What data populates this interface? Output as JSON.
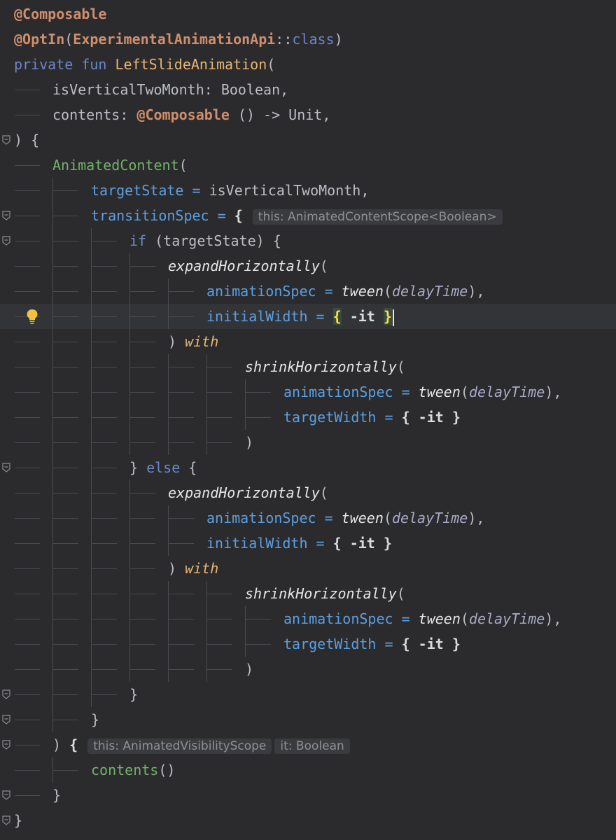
{
  "editor": {
    "hints": {
      "transition_scope": "this: AnimatedContentScope<Boolean>",
      "visibility_scope": "this: AnimatedVisibilityScope",
      "it_type": "it: Boolean"
    },
    "lines": [
      {
        "indent": 0,
        "tokens": [
          [
            "@Composable",
            "annotation"
          ]
        ]
      },
      {
        "indent": 0,
        "tokens": [
          [
            "@OptIn",
            "annotation"
          ],
          [
            "(",
            "punct"
          ],
          [
            "ExperimentalAnimationApi",
            "annotation"
          ],
          [
            "::",
            "punct"
          ],
          [
            "class",
            "keyword"
          ],
          [
            ")",
            "punct"
          ]
        ]
      },
      {
        "indent": 0,
        "tokens": [
          [
            "private fun ",
            "keyword"
          ],
          [
            "LeftSlideAnimation",
            "fn-decl"
          ],
          [
            "(",
            "punct"
          ]
        ]
      },
      {
        "indent": 1,
        "tokens": [
          [
            "isVerticalTwoMonth",
            "param"
          ],
          [
            ": Boolean,",
            "type"
          ]
        ]
      },
      {
        "indent": 1,
        "tokens": [
          [
            "contents",
            "param"
          ],
          [
            ": ",
            "punct"
          ],
          [
            "@Composable",
            "annotation"
          ],
          [
            " () -> Unit,",
            "type"
          ]
        ]
      },
      {
        "indent": 0,
        "fold": true,
        "tokens": [
          [
            ") {",
            "punct"
          ]
        ]
      },
      {
        "indent": 1,
        "tokens": [
          [
            "AnimatedContent",
            "call-green"
          ],
          [
            "(",
            "punct"
          ]
        ]
      },
      {
        "indent": 2,
        "tokens": [
          [
            "targetState",
            "named-arg"
          ],
          [
            " = ",
            "op"
          ],
          [
            "isVerticalTwoMonth,",
            "param"
          ]
        ]
      },
      {
        "indent": 2,
        "fold": true,
        "tokens": [
          [
            "transitionSpec",
            "named-arg"
          ],
          [
            " = ",
            "op"
          ],
          [
            "{ ",
            "bold"
          ]
        ],
        "hint": "transition_scope"
      },
      {
        "indent": 3,
        "fold": true,
        "tokens": [
          [
            "if",
            "keyword"
          ],
          [
            " (targetState) {",
            "punct"
          ]
        ]
      },
      {
        "indent": 4,
        "tokens": [
          [
            "expandHorizontally",
            "italic-fn"
          ],
          [
            "(",
            "punct"
          ]
        ]
      },
      {
        "indent": 5,
        "tokens": [
          [
            "animationSpec",
            "named-arg"
          ],
          [
            " = ",
            "op"
          ],
          [
            "tween",
            "italic-fn"
          ],
          [
            "(",
            "punct"
          ],
          [
            "delayTime",
            "italic-var"
          ],
          [
            "),",
            "punct"
          ]
        ]
      },
      {
        "indent": 5,
        "current": true,
        "bulb": true,
        "tokens": [
          [
            "initialWidth",
            "named-arg"
          ],
          [
            " = ",
            "op"
          ],
          [
            "{",
            "brace-hl"
          ],
          [
            " -it ",
            "bold"
          ],
          [
            "}",
            "brace-hl"
          ]
        ],
        "caret": true
      },
      {
        "indent": 4,
        "tokens": [
          [
            ") ",
            "punct"
          ],
          [
            "with",
            "infix"
          ]
        ]
      },
      {
        "indent": 6,
        "tokens": [
          [
            "shrinkHorizontally",
            "italic-fn"
          ],
          [
            "(",
            "punct"
          ]
        ]
      },
      {
        "indent": 7,
        "tokens": [
          [
            "animationSpec",
            "named-arg"
          ],
          [
            " = ",
            "op"
          ],
          [
            "tween",
            "italic-fn"
          ],
          [
            "(",
            "punct"
          ],
          [
            "delayTime",
            "italic-var"
          ],
          [
            "),",
            "punct"
          ]
        ]
      },
      {
        "indent": 7,
        "tokens": [
          [
            "targetWidth",
            "named-arg"
          ],
          [
            " = ",
            "op"
          ],
          [
            "{ -it }",
            "bold"
          ]
        ]
      },
      {
        "indent": 6,
        "tokens": [
          [
            ")",
            "punct"
          ]
        ]
      },
      {
        "indent": 3,
        "fold": true,
        "tokens": [
          [
            "} ",
            "punct"
          ],
          [
            "else",
            "keyword"
          ],
          [
            " {",
            "punct"
          ]
        ]
      },
      {
        "indent": 4,
        "tokens": [
          [
            "expandHorizontally",
            "italic-fn"
          ],
          [
            "(",
            "punct"
          ]
        ]
      },
      {
        "indent": 5,
        "tokens": [
          [
            "animationSpec",
            "named-arg"
          ],
          [
            " = ",
            "op"
          ],
          [
            "tween",
            "italic-fn"
          ],
          [
            "(",
            "punct"
          ],
          [
            "delayTime",
            "italic-var"
          ],
          [
            "),",
            "punct"
          ]
        ]
      },
      {
        "indent": 5,
        "tokens": [
          [
            "initialWidth",
            "named-arg"
          ],
          [
            " = ",
            "op"
          ],
          [
            "{ -it }",
            "bold"
          ]
        ]
      },
      {
        "indent": 4,
        "tokens": [
          [
            ") ",
            "punct"
          ],
          [
            "with",
            "infix"
          ]
        ]
      },
      {
        "indent": 6,
        "tokens": [
          [
            "shrinkHorizontally",
            "italic-fn"
          ],
          [
            "(",
            "punct"
          ]
        ]
      },
      {
        "indent": 7,
        "tokens": [
          [
            "animationSpec",
            "named-arg"
          ],
          [
            " = ",
            "op"
          ],
          [
            "tween",
            "italic-fn"
          ],
          [
            "(",
            "punct"
          ],
          [
            "delayTime",
            "italic-var"
          ],
          [
            "),",
            "punct"
          ]
        ]
      },
      {
        "indent": 7,
        "tokens": [
          [
            "targetWidth",
            "named-arg"
          ],
          [
            " = ",
            "op"
          ],
          [
            "{ -it }",
            "bold"
          ]
        ]
      },
      {
        "indent": 6,
        "tokens": [
          [
            ")",
            "punct"
          ]
        ]
      },
      {
        "indent": 3,
        "fold": true,
        "tokens": [
          [
            "}",
            "punct"
          ]
        ]
      },
      {
        "indent": 2,
        "fold": true,
        "tokens": [
          [
            "}",
            "punct"
          ]
        ]
      },
      {
        "indent": 1,
        "fold": true,
        "tokens": [
          [
            ") ",
            "punct"
          ],
          [
            "{ ",
            "bold"
          ]
        ],
        "hint": "visibility_scope",
        "hint2": "it_type"
      },
      {
        "indent": 2,
        "tokens": [
          [
            "contents",
            "call-green"
          ],
          [
            "()",
            "punct"
          ]
        ]
      },
      {
        "indent": 1,
        "fold": true,
        "tokens": [
          [
            "}",
            "punct"
          ]
        ]
      },
      {
        "indent": 0,
        "fold": true,
        "tokens": [
          [
            "}",
            "punct"
          ]
        ]
      }
    ]
  }
}
